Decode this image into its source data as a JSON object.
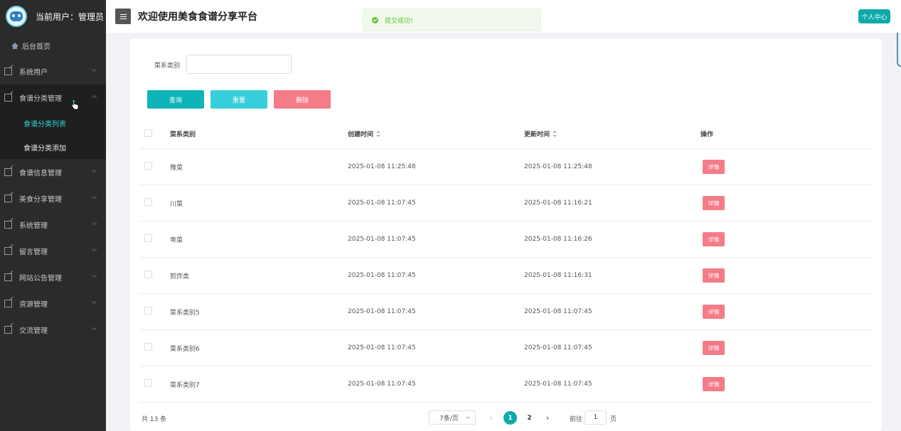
{
  "sidebar": {
    "user_label": "当前用户：管理员",
    "home": "后台首页",
    "items": [
      {
        "label": "系统用户"
      },
      {
        "label": "食谱分类管理"
      },
      {
        "label": "食谱信息管理"
      },
      {
        "label": "美食分享管理"
      },
      {
        "label": "系统管理"
      },
      {
        "label": "留言管理"
      },
      {
        "label": "网站公告管理"
      },
      {
        "label": "资源管理"
      },
      {
        "label": "交流管理"
      }
    ],
    "submenu": [
      {
        "label": "食谱分类列表"
      },
      {
        "label": "食谱分类添加"
      }
    ]
  },
  "header": {
    "title": "欢迎使用美食食谱分享平台",
    "profile": "个人中心"
  },
  "toast": {
    "message": "提交成功!"
  },
  "search": {
    "label": "菜系类别",
    "value": ""
  },
  "actions": {
    "query": "查询",
    "reset": "重置",
    "delete": "删除"
  },
  "table": {
    "columns": [
      "菜系类别",
      "创建时间",
      "更新时间",
      "操作"
    ],
    "detail_label": "详情",
    "rows": [
      {
        "name": "豫菜",
        "created": "2025-01-08 11:25:48",
        "updated": "2025-01-08 11:25:48"
      },
      {
        "name": "川菜",
        "created": "2025-01-08 11:07:45",
        "updated": "2025-01-08 11:16:21"
      },
      {
        "name": "粤菜",
        "created": "2025-01-08 11:07:45",
        "updated": "2025-01-08 11:16:26"
      },
      {
        "name": "煎炸类",
        "created": "2025-01-08 11:07:45",
        "updated": "2025-01-08 11:16:31"
      },
      {
        "name": "菜系类别5",
        "created": "2025-01-08 11:07:45",
        "updated": "2025-01-08 11:07:45"
      },
      {
        "name": "菜系类别6",
        "created": "2025-01-08 11:07:45",
        "updated": "2025-01-08 11:07:45"
      },
      {
        "name": "菜系类别7",
        "created": "2025-01-08 11:07:45",
        "updated": "2025-01-08 11:07:45"
      }
    ]
  },
  "pagination": {
    "total": "共 13 条",
    "page_size": "7条/页",
    "prev": "‹",
    "next": "›",
    "pages": [
      "1",
      "2"
    ],
    "goto_prefix": "前往",
    "goto_value": "1",
    "goto_suffix": "页"
  },
  "colors": {
    "primary": "#0eaaa9",
    "danger": "#f47b88",
    "sidebar": "#2b2b2b"
  }
}
